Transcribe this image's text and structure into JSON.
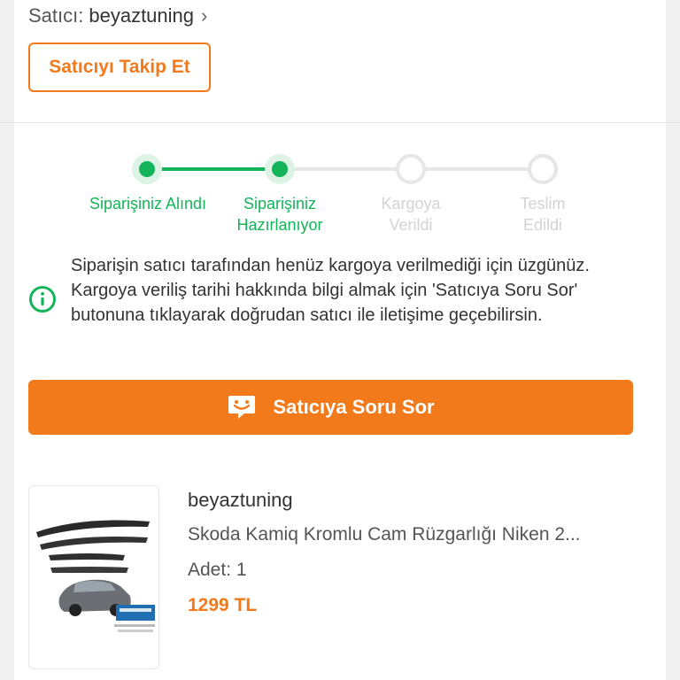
{
  "seller": {
    "prefix": "Satıcı:",
    "name": "beyaztuning",
    "follow_label": "Satıcıyı Takip Et"
  },
  "steps": [
    {
      "label": "Siparişiniz Alındı",
      "status": "done"
    },
    {
      "label": "Siparişiniz Hazırlanıyor",
      "status": "done"
    },
    {
      "label": "Kargoya Verildi",
      "status": "pending"
    },
    {
      "label": "Teslim Edildi",
      "status": "pending"
    }
  ],
  "info": {
    "text": "Siparişin satıcı tarafından henüz kargoya verilmediği için üzgünüz. Kargoya veriliş tarihi hakkında bilgi almak için 'Satıcıya Soru Sor' butonuna tıklayarak doğrudan satıcı ile iletişime geçebilirsin.",
    "icon": "info-icon"
  },
  "ask_button": {
    "label": "Satıcıya Soru Sor",
    "icon": "chat-icon"
  },
  "product": {
    "seller": "beyaztuning",
    "name": "Skoda Kamiq Kromlu Cam Rüzgarlığı Niken 2...",
    "quantity": "Adet: 1",
    "price": "1299 TL"
  },
  "colors": {
    "accent": "#f27a1a",
    "success": "#14b45a",
    "inactive": "#e6e6e6"
  }
}
